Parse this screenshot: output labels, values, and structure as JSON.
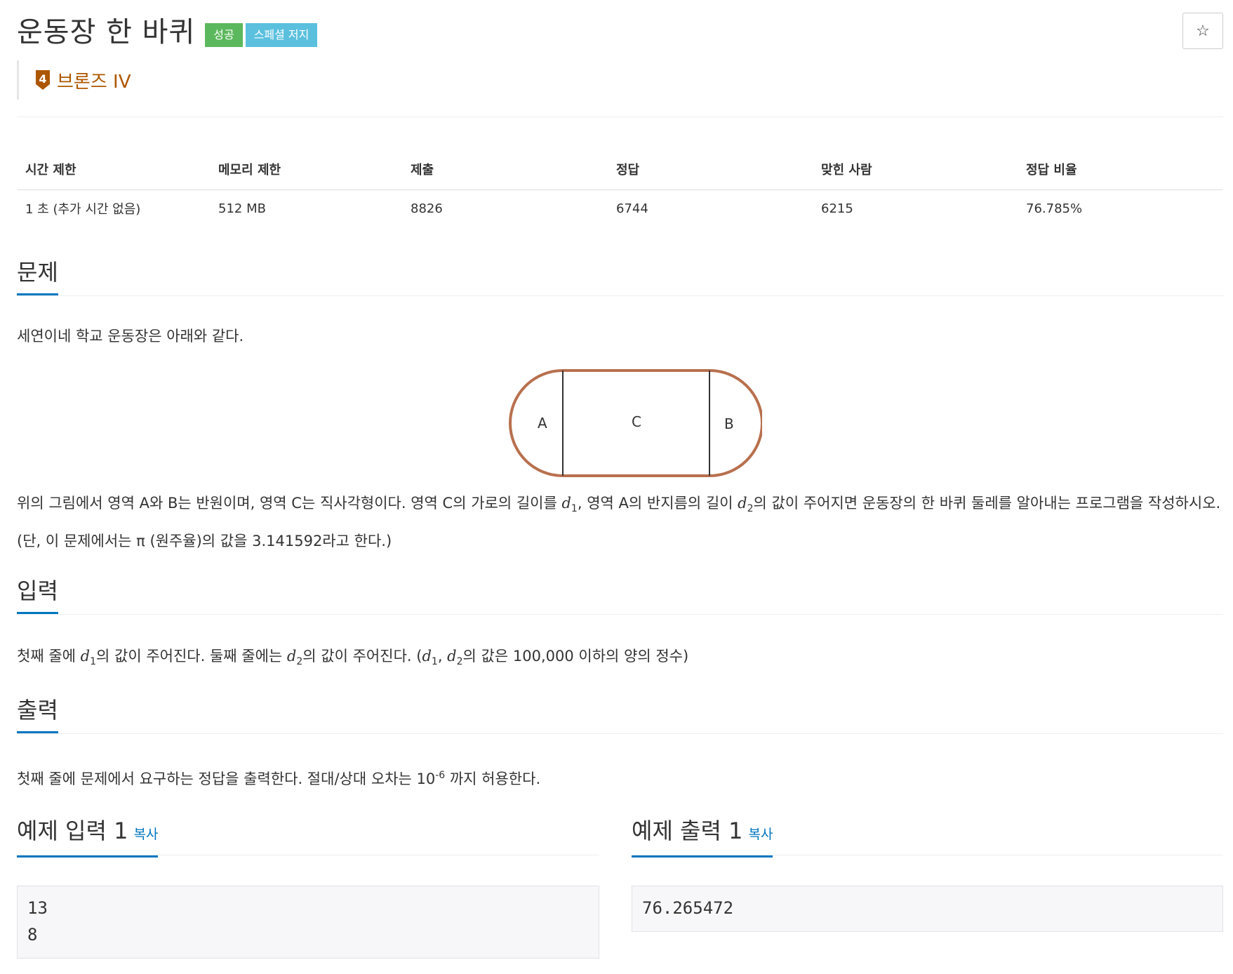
{
  "header": {
    "title": "운동장 한 바퀴",
    "badges": [
      "성공",
      "스페셜 저지"
    ],
    "star_icon": "☆",
    "tier_number": "4",
    "tier_label": "브론즈 IV",
    "tier_color": "#ad5600"
  },
  "stats": {
    "headers": [
      "시간 제한",
      "메모리 제한",
      "제출",
      "정답",
      "맞힌 사람",
      "정답 비율"
    ],
    "values": [
      "1 초 (추가 시간 없음)",
      "512 MB",
      "8826",
      "6744",
      "6215",
      "76.785%"
    ]
  },
  "problem": {
    "heading": "문제",
    "intro": "세연이네 학교 운동장은 아래와 같다.",
    "figure_labels": {
      "a": "A",
      "c": "C",
      "b": "B"
    },
    "desc": {
      "p1": "위의 그림에서 영역 A와 B는 반원이며, 영역 C는 직사각형이다. 영역 C의 가로의 길이를 ",
      "var1": "d",
      "sub1": "1",
      "p2": ", 영역 A의 반지름의 길이 ",
      "var2": "d",
      "sub2": "2",
      "p3": "의 값이 주어지면 운동장의 한 바퀴 둘레를 알아내는 프로그램을 작성하시오. (단, 이 문제에서는 π (원주율)의 값을 3.141592라고 한다.)"
    }
  },
  "input": {
    "heading": "입력",
    "t1": "첫째 줄에 ",
    "v1": "d",
    "s1": "1",
    "t2": "의 값이 주어진다. 둘째 줄에는 ",
    "v2": "d",
    "s2": "2",
    "t3": "의 값이 주어진다. (",
    "v3": "d",
    "s3": "1",
    "t4": ", ",
    "v4": "d",
    "s4": "2",
    "t5": "의 값은 100,000 이하의 양의 정수)"
  },
  "output": {
    "heading": "출력",
    "t1": "첫째 줄에 문제에서 요구하는 정답을 출력한다. 절대/상대 오차는 10",
    "sup": "-6",
    "t2": " 까지 허용한다."
  },
  "samples": {
    "input_title": "예제 입력 1",
    "output_title": "예제 출력 1",
    "copy_label": "복사",
    "input_value": "13\n8",
    "output_value": "76.265472"
  }
}
